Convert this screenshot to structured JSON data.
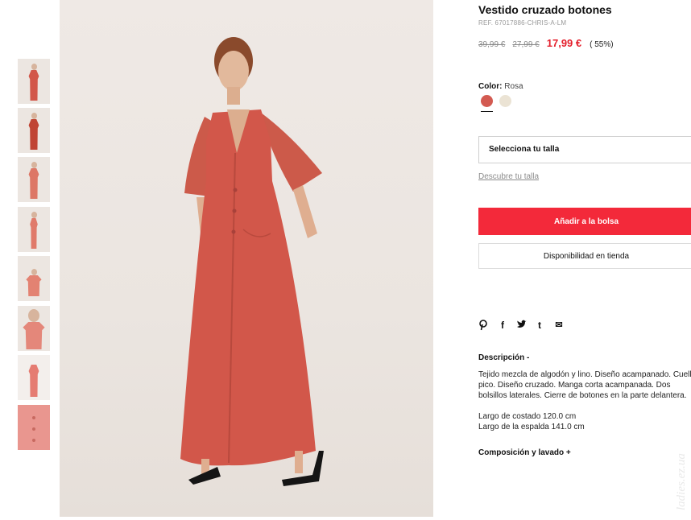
{
  "product": {
    "title": "Vestido cruzado botones",
    "ref": "REF. 67017886-CHRIS-A-LM",
    "old_price_1": "39,99 €",
    "old_price_2": "27,99 €",
    "price": "17,99 €",
    "discount": "( 55%)"
  },
  "color": {
    "label": "Color:",
    "selected": "Rosa",
    "options": [
      {
        "name": "rosa",
        "hex": "#d35a51"
      },
      {
        "name": "crudo",
        "hex": "#ebe3d4"
      }
    ]
  },
  "size": {
    "select_label": "Selecciona tu talla",
    "help_link": "Descubre tu talla"
  },
  "actions": {
    "add_to_bag": "Añadir a la bolsa",
    "store_availability": "Disponibilidad en tienda"
  },
  "share": {
    "icons": [
      "pinterest-icon",
      "facebook-icon",
      "twitter-icon",
      "tumblr-icon",
      "email-icon"
    ],
    "glyphs": [
      "℗",
      "f",
      "✦",
      "t",
      "✉"
    ]
  },
  "description": {
    "title": "Descripción -",
    "lines": [
      "Tejido mezcla de algodón y lino. Diseño acampanado. Cuello",
      "pico. Diseño cruzado. Manga corta acampanada. Dos",
      "bolsillos laterales. Cierre de botones en la parte delantera."
    ],
    "measure_1": "Largo de costado 120.0 cm",
    "measure_2": "Largo de la espalda 141.0 cm"
  },
  "composition": {
    "title": "Composición y lavado +"
  },
  "watermark": "ladies.ez.ua",
  "thumbnail_count": 8,
  "accent_colors": {
    "sale_red": "#f3293a",
    "dress": "#d2574a",
    "background": "#ece6e1"
  }
}
